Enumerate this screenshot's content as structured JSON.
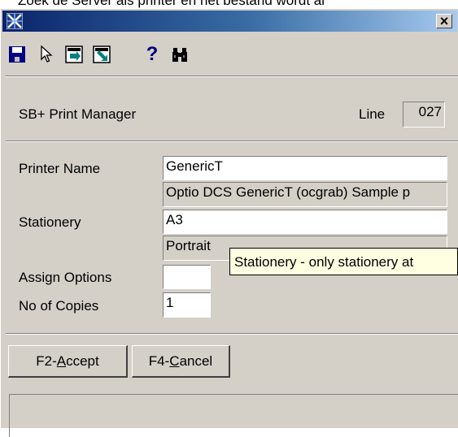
{
  "page_caption": "Zoek de Server als printer en het bestand wordt al",
  "window": {
    "title": "",
    "close_label": "×"
  },
  "toolbar": {
    "icons": [
      "save-icon",
      "pointer-icon",
      "export-icon",
      "import-icon",
      "help-icon",
      "binoculars-icon"
    ],
    "help_glyph": "?"
  },
  "header": {
    "title": "SB+ Print Manager",
    "line_label": "Line",
    "line_value": "027"
  },
  "form": {
    "printer_name_label": "Printer Name",
    "printer_name_value": "GenericT",
    "printer_description": "Optio DCS GenericT (ocgrab) Sample p",
    "stationery_label": "Stationery",
    "stationery_value": "A3",
    "orientation": "Portrait",
    "assign_options_label": "Assign Options",
    "assign_options_value": "",
    "copies_label": "No of Copies",
    "copies_value": "1"
  },
  "tooltip": {
    "text": "Stationery - only stationery at"
  },
  "buttons": {
    "accept_prefix": "F2-",
    "accept_key": "A",
    "accept_rest": "ccept",
    "cancel_prefix": "F4-",
    "cancel_key": "C",
    "cancel_rest": "ancel"
  },
  "status": {
    "text": ""
  },
  "colors": {
    "titlebar_start": "#0a246a",
    "titlebar_end": "#a6caf0",
    "window_bg": "#d4d0c8",
    "tooltip_bg": "#ffffe1",
    "save_icon": "#000080",
    "help_icon": "#000080"
  }
}
